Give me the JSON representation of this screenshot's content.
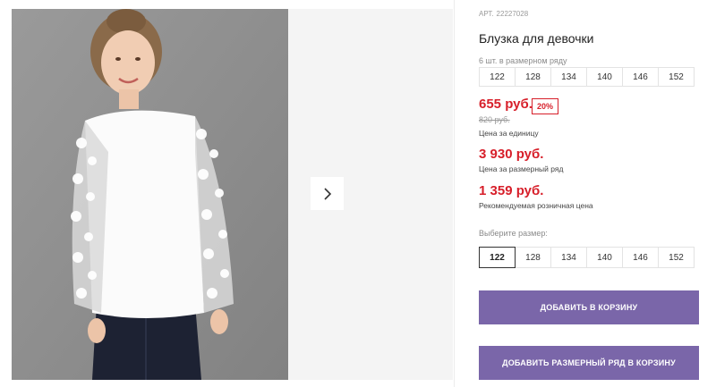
{
  "product": {
    "sku_label": "АРТ.",
    "sku": "22227028",
    "title": "Блузка для девочки",
    "row_note": "6 шт. в размерном ряду",
    "row_sizes": [
      "122",
      "128",
      "134",
      "140",
      "146",
      "152"
    ],
    "price": "655 руб.",
    "discount": "20%",
    "old_price": "820 руб.",
    "price_caption": "Цена за единицу",
    "row_price": "3 930 руб.",
    "row_price_caption": "Цена за размерный ряд",
    "retail_price": "1 359 руб.",
    "retail_caption": "Рекомендуемая розничная цена",
    "choose_size_label": "Выберите размер:",
    "select_sizes": [
      "122",
      "128",
      "134",
      "140",
      "146",
      "152"
    ],
    "selected_size": "122",
    "add_to_cart": "ДОБАВИТЬ В КОРЗИНУ",
    "add_row_to_cart": "ДОБАВИТЬ РАЗМЕРНЫЙ РЯД В КОРЗИНУ"
  },
  "colors": {
    "price_red": "#d71f2a",
    "button_purple": "#7a66a9",
    "photo_bg": "#8e8e8e"
  },
  "icons": {
    "next": "chevron-right-icon"
  }
}
